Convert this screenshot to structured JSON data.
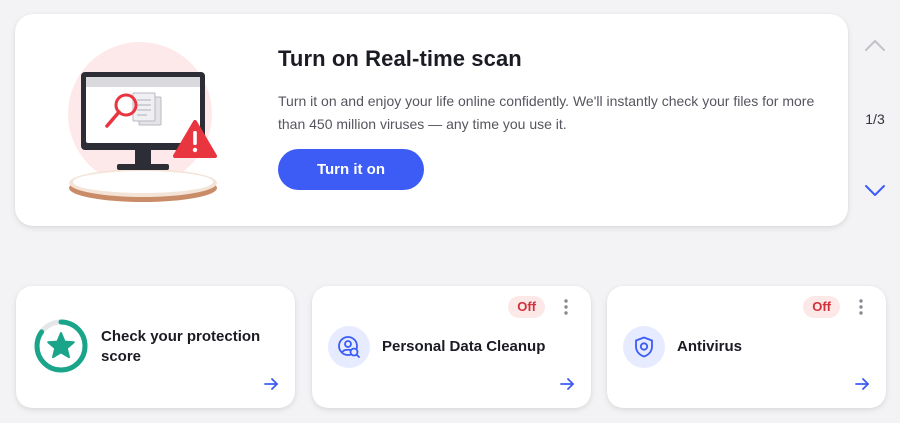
{
  "hero": {
    "title": "Turn on Real-time scan",
    "description": "Turn it on and enjoy your life online confidently. We'll instantly check your files for more than 450 million viruses — any time you use it.",
    "cta_label": "Turn it on",
    "illustration": "computer-with-magnifier-warning-illustration"
  },
  "pager": {
    "counter": "1/3",
    "up_icon": "chevron-up-icon",
    "down_icon": "chevron-down-icon"
  },
  "cards": [
    {
      "title": "Check your protection score",
      "icon": "star-score-ring-icon",
      "arrow_icon": "arrow-right-icon"
    },
    {
      "title": "Personal Data Cleanup",
      "status": "Off",
      "icon": "person-search-icon",
      "menu_icon": "more-vertical-icon",
      "arrow_icon": "arrow-right-icon"
    },
    {
      "title": "Antivirus",
      "status": "Off",
      "icon": "shield-icon",
      "menu_icon": "more-vertical-icon",
      "arrow_icon": "arrow-right-icon"
    }
  ],
  "colors": {
    "accent": "#3c5cf5",
    "score_ring": "#1aa58a",
    "status_off_bg": "#fde8e8",
    "status_off_text": "#d0313b",
    "icon_bg": "#e6ebff",
    "warning": "#e8353f"
  }
}
